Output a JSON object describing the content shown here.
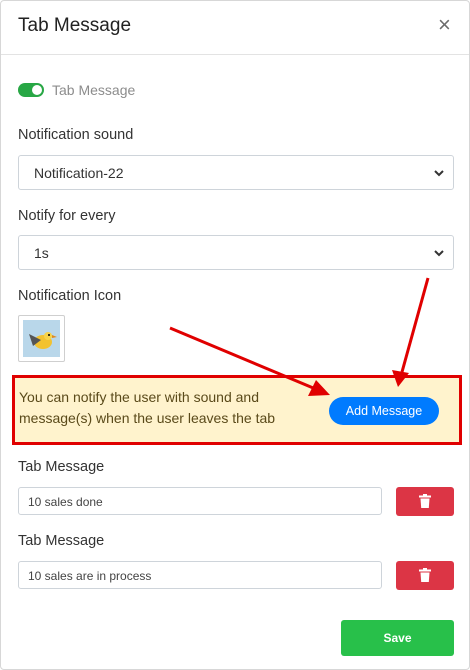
{
  "dialog": {
    "title": "Tab Message",
    "close_glyph": "×"
  },
  "toggle": {
    "label": "Tab Message",
    "enabled": true,
    "color": "#28a745"
  },
  "sound": {
    "label": "Notification sound",
    "value": "Notification-22"
  },
  "frequency": {
    "label": "Notify for every",
    "value": "1s"
  },
  "icon": {
    "label": "Notification Icon",
    "icon_name": "bird-thumbnail-icon"
  },
  "info": {
    "line1": "You can notify the user with sound and",
    "line2": "message(s) when the user leaves the tab",
    "button": "Add Message",
    "highlight_color": "#e00000"
  },
  "messages": [
    {
      "label": "Tab Message",
      "value": "10 sales done"
    },
    {
      "label": "Tab Message",
      "value": "10 sales are in process"
    }
  ],
  "footer": {
    "save": "Save",
    "save_color": "#28c04a"
  },
  "colors": {
    "primary": "#007bff",
    "danger": "#dc3545",
    "warning_bg": "#fff3cd"
  }
}
